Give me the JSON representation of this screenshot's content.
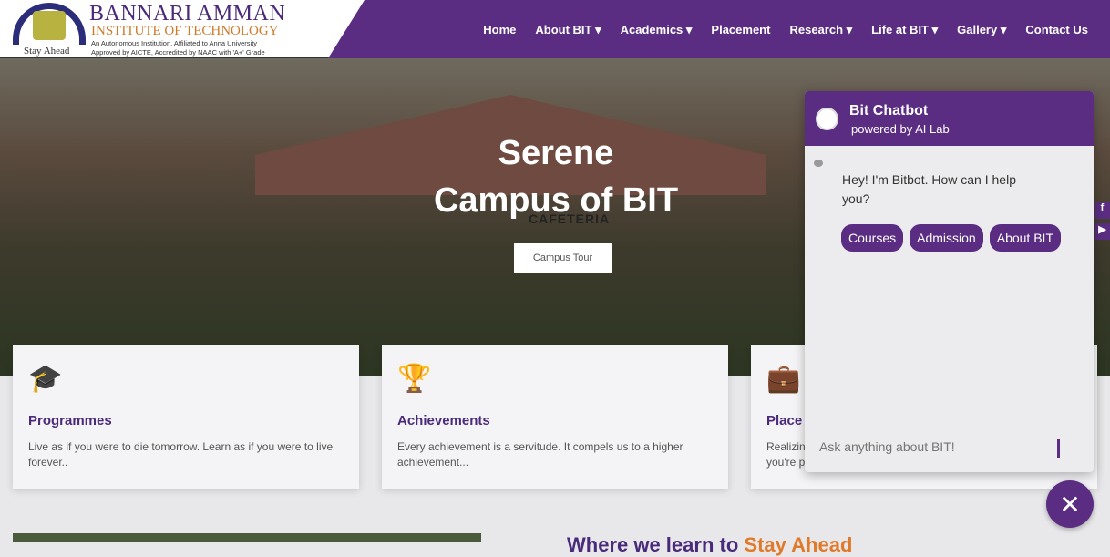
{
  "header": {
    "logo": {
      "name": "BANNARI AMMAN",
      "subtitle": "INSTITUTE OF TECHNOLOGY",
      "line1": "An Autonomous Institution, Affiliated to Anna University",
      "line2": "Approved by AICTE, Accredited by NAAC with 'A+' Grade",
      "tagline": "Stay Ahead"
    },
    "menu": [
      "Home",
      "About BIT ▾",
      "Academics ▾",
      "Placement",
      "Research ▾",
      "Life at BIT ▾",
      "Gallery ▾",
      "Contact Us"
    ]
  },
  "hero": {
    "title_line1": "Serene",
    "title_line2": "Campus of BIT",
    "sign": "CAFETERIA",
    "button": "Campus Tour"
  },
  "cards": [
    {
      "icon": "graduation-cap-icon",
      "title": "Programmes",
      "text": "Live as if you were to die tomorrow. Learn as if you were to live forever.."
    },
    {
      "icon": "trophy-icon",
      "title": "Achievements",
      "text": "Every achievement is a servitude. It compels us to a higher achievement..."
    },
    {
      "icon": "briefcase-icon",
      "title": "Place",
      "text": "Realizin you're p"
    }
  ],
  "chatbot": {
    "title": "Bit Chatbot",
    "subtitle": "powered by AI Lab",
    "message": "Hey! I'm Bitbot. How can I help you?",
    "options": [
      "Courses",
      "Admission",
      "About BIT"
    ],
    "input_placeholder": "Ask anything about BIT!",
    "close": "✕"
  },
  "section": {
    "heading": "Where we learn to ",
    "heading_accent": "Stay Ahead"
  },
  "colors": {
    "brand": "#5a2d82",
    "accent": "#e07a2a"
  }
}
